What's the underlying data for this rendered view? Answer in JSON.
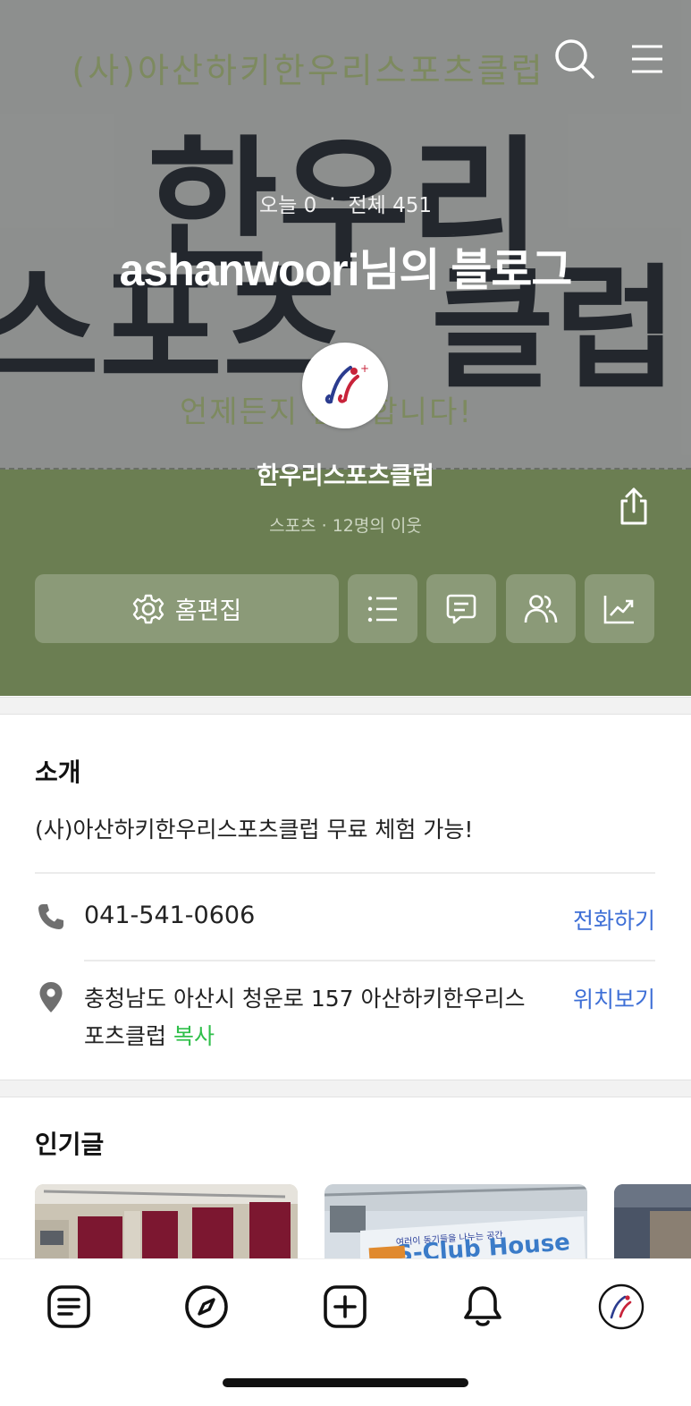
{
  "hero": {
    "banner_top_text": "(사)아산하키한우리스포츠클럽",
    "banner_big_line1": "한우리",
    "banner_big_line2a": "스포츠",
    "banner_big_line2b": "클럽",
    "banner_bottom_text": "언제든지 환영합니다!",
    "today_label": "오늘 0",
    "dot": "·",
    "total_label": "전체 451",
    "blog_title": "ashanwoori님의 블로그",
    "club_name": "한우리스포츠클럽",
    "club_meta": "스포츠 · 12명의 이웃"
  },
  "actions": {
    "edit_label": "홈편집"
  },
  "intro": {
    "heading": "소개",
    "text": "(사)아산하키한우리스포츠클럽 무료 체험 가능!",
    "phone": "041-541-0606",
    "call_label": "전화하기",
    "address": "충청남도 아산시 청운로 157 아산하키한우리스포츠클럽",
    "copy_label": "복사",
    "map_label": "위치보기"
  },
  "popular": {
    "heading": "인기글",
    "thumb2_sign_top": "여러이 동기들을 나누는 공간",
    "thumb2_sign_main": "S-Club House"
  },
  "colors": {
    "accent_green": "#6b7e52",
    "link_blue": "#3e6fd6",
    "copy_green": "#2fbf4a"
  },
  "icons": {
    "top": [
      "search-icon",
      "menu-icon"
    ],
    "share": "share-icon",
    "actions": [
      "gear-icon",
      "list-icon",
      "comment-icon",
      "neighbors-icon",
      "stats-icon"
    ],
    "rows": [
      "phone-icon",
      "location-pin-icon"
    ],
    "tabbar": [
      "feed-icon",
      "compass-icon",
      "add-post-icon",
      "bell-icon",
      "profile-avatar-icon"
    ]
  }
}
